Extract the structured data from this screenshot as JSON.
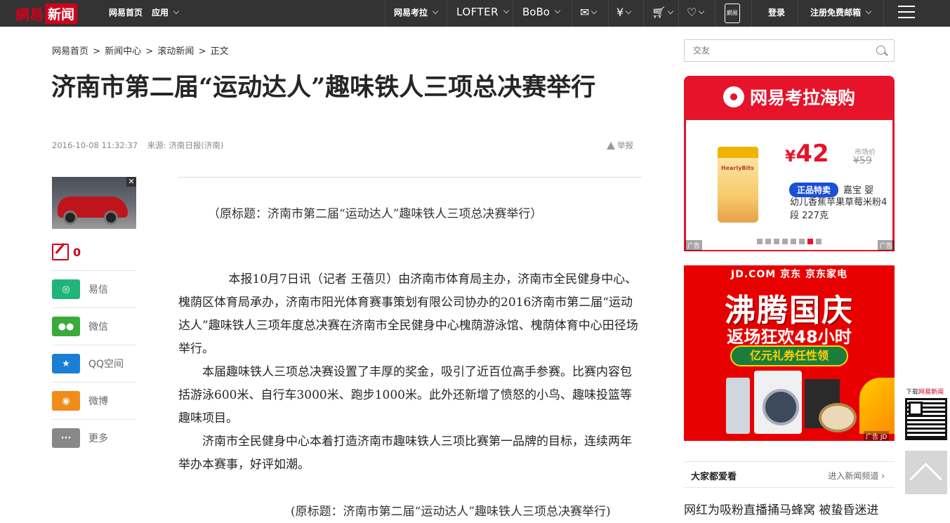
{
  "topbar": {
    "logo_part1": "網易",
    "logo_part2": "新闻",
    "home_link": "网易首页",
    "apps_link": "应用",
    "kaola_link": "网易考拉",
    "lofter_link": "LOFTER",
    "bobo_link": "BoBo",
    "app_icon_label": "網易",
    "login": "登录",
    "register": "注册免费邮箱",
    "icons": [
      "mail-icon",
      "yen-icon",
      "cart-icon",
      "heart-icon",
      "phone-icon",
      "menu-icon"
    ]
  },
  "breadcrumb": [
    "网易首页",
    ">",
    "新闻中心",
    ">",
    "滚动新闻",
    ">",
    "正文"
  ],
  "article": {
    "title": "济南市第二届“运动达人”趣味铁人三项总决赛举行",
    "datetime": "2016-10-08 11:32:37",
    "source": "来源: 济南日报(济南)",
    "report": "举报",
    "original_title_top": "（原标题：济南市第二届“运动达人”趣味铁人三项总决赛举行）",
    "paragraphs": [
      "本报10月7日讯（记者 王蓓贝）由济南市体育局主办，济南市全民健身中心、槐荫区体育局承办，济南市阳光体育赛事策划有限公司协办的2016济南市第二届“运动达人”趣味铁人三项年度总决赛在济南市全民健身中心槐荫游泳馆、槐荫体育中心田径场举行。",
      "本届趣味铁人三项总决赛设置了丰厚的奖金，吸引了近百位高手参赛。比赛内容包括游泳600米、自行车3000米、跑步1000米。此外还新增了愤怒的小鸟、趣味投篮等趣味项目。",
      "济南市全民健身中心本着打造济南市趣味铁人三项比赛第一品牌的目标，连续两年举办本赛事，好评如潮。"
    ],
    "original_title_bottom": "(原标题：济南市第二届“运动达人”趣味铁人三项总决赛举行)"
  },
  "left": {
    "ad_close": "✕",
    "comment_count": "0",
    "share": [
      {
        "label": "易信",
        "color": "#20b47a",
        "glyph": "◎"
      },
      {
        "label": "微信",
        "color": "#3aab3a",
        "glyph": "●●"
      },
      {
        "label": "QQ空间",
        "color": "#1a7fd4",
        "glyph": "★"
      },
      {
        "label": "微博",
        "color": "#f08c1a",
        "glyph": "◉"
      },
      {
        "label": "更多",
        "color": "#888888",
        "glyph": "···"
      }
    ]
  },
  "search": {
    "placeholder": "交友"
  },
  "kaola_ad": {
    "header": "网易考拉海购",
    "price_symbol": "¥",
    "price": "42",
    "market_label": "市场价",
    "market_price": "¥59",
    "tag": "正品特卖",
    "name_part1": "嘉宝 婴",
    "name_part2": "幼儿香蕉苹果草莓米粉4段 227克",
    "jar_label": "HearlyBits",
    "ad_label": "广告",
    "dots_count": 8,
    "active_dot": 7
  },
  "jd_ad": {
    "top": "JD.COM 京东    京东家电",
    "headline": "沸腾国庆",
    "subline": "返场狂欢48小时",
    "pill": "亿元礼券任性领",
    "ad_label": "广告 JD"
  },
  "popular": {
    "heading": "大家都爱看",
    "more": "进入新闻频道 ›",
    "first_item": "网红为吸粉直播捅马蜂窝 被蛰昏迷进"
  },
  "app_download": {
    "text_a": "下载",
    "text_b": "网易新闻"
  },
  "colors": {
    "brand_red": "#d0021b",
    "topbar": "#333333",
    "kaola_red": "#e6132a",
    "jd_red": "#e80000"
  }
}
